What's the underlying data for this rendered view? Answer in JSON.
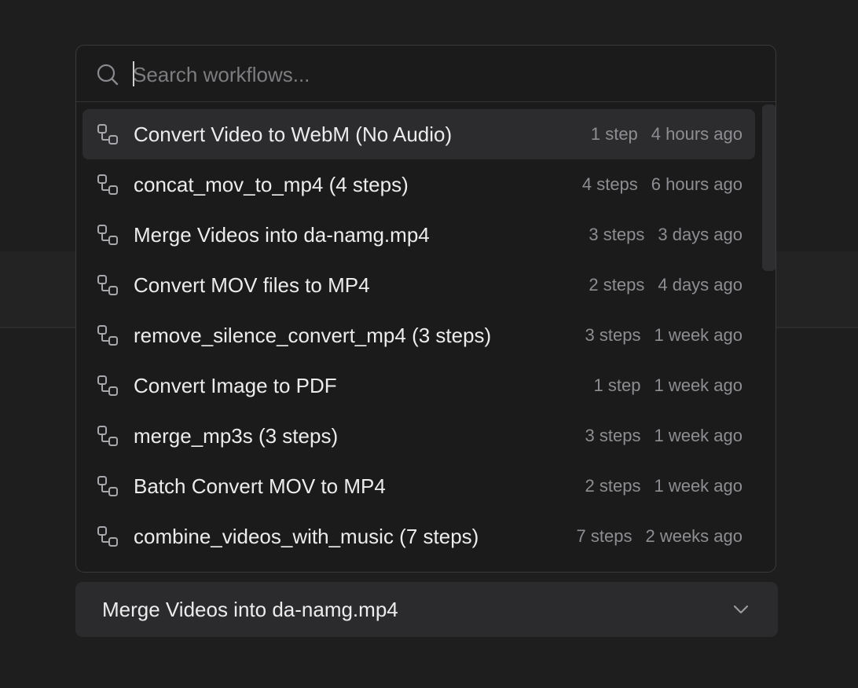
{
  "search": {
    "placeholder": "Search workflows...",
    "value": ""
  },
  "workflows": [
    {
      "title": "Convert Video to WebM (No Audio)",
      "steps": "1 step",
      "time": "4 hours ago",
      "selected": true
    },
    {
      "title": "concat_mov_to_mp4 (4 steps)",
      "steps": "4 steps",
      "time": "6 hours ago",
      "selected": false
    },
    {
      "title": "Merge Videos into da-namg.mp4",
      "steps": "3 steps",
      "time": "3 days ago",
      "selected": false
    },
    {
      "title": "Convert MOV files to MP4",
      "steps": "2 steps",
      "time": "4 days ago",
      "selected": false
    },
    {
      "title": "remove_silence_convert_mp4 (3 steps)",
      "steps": "3 steps",
      "time": "1 week ago",
      "selected": false
    },
    {
      "title": "Convert Image to PDF",
      "steps": "1 step",
      "time": "1 week ago",
      "selected": false
    },
    {
      "title": "merge_mp3s (3 steps)",
      "steps": "3 steps",
      "time": "1 week ago",
      "selected": false
    },
    {
      "title": "Batch Convert MOV to MP4",
      "steps": "2 steps",
      "time": "1 week ago",
      "selected": false
    },
    {
      "title": "combine_videos_with_music (7 steps)",
      "steps": "7 steps",
      "time": "2 weeks ago",
      "selected": false
    }
  ],
  "selector": {
    "value": "Merge Videos into da-namg.mp4"
  },
  "icons": {
    "search": "search-icon",
    "workflow": "workflow-icon",
    "chevron": "chevron-down-icon"
  },
  "colors": {
    "background": "#1e1e1f",
    "popup": "#1b1b1c",
    "selected_row": "#2c2c2e",
    "text": "#ececec",
    "muted_text": "#8e8e92"
  }
}
